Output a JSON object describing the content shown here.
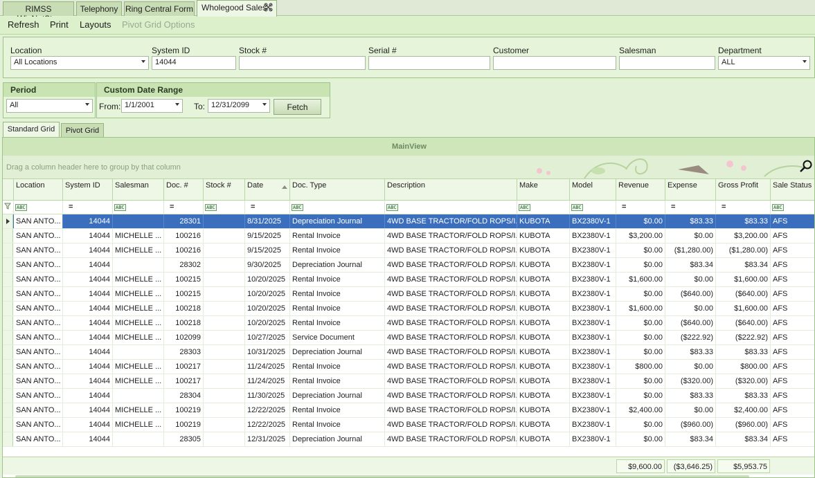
{
  "doc_tabs": [
    "RIMSS WinNetStar",
    "Telephony",
    "Ring Central Form",
    "Wholegood Sales"
  ],
  "toolbar": [
    "Refresh",
    "Print",
    "Layouts",
    "Pivot Grid Options"
  ],
  "filters": {
    "location": {
      "label": "Location",
      "value": "All Locations"
    },
    "system_id": {
      "label": "System ID",
      "value": "14044"
    },
    "stock": {
      "label": "Stock #",
      "value": ""
    },
    "serial": {
      "label": "Serial #",
      "value": ""
    },
    "customer": {
      "label": "Customer",
      "value": ""
    },
    "salesman": {
      "label": "Salesman",
      "value": ""
    },
    "department": {
      "label": "Department",
      "value": "ALL"
    }
  },
  "period": {
    "title": "Period",
    "value": "All"
  },
  "date_range": {
    "title": "Custom Date Range",
    "from_label": "From:",
    "from_value": "1/1/2001",
    "to_label": "To:",
    "to_value": "12/31/2099",
    "fetch_label": "Fetch"
  },
  "view_tabs": [
    "Standard Grid",
    "Pivot Grid"
  ],
  "grid": {
    "title": "MainView",
    "group_hint": "Drag a column header here to group by that column",
    "columns": [
      "Location",
      "System ID",
      "Salesman",
      "Doc. #",
      "Stock #",
      "Date",
      "Doc. Type",
      "Description",
      "Make",
      "Model",
      "Revenue",
      "Expense",
      "Gross Profit",
      "Sale Status"
    ],
    "rows": [
      [
        "SAN ANTO...",
        "14044",
        "",
        "28301",
        "",
        "8/31/2025",
        "Depreciation Journal",
        "4WD BASE TRACTOR/FOLD ROPS/I...",
        "KUBOTA",
        "BX2380V-1",
        "$0.00",
        "$83.33",
        "$83.33",
        "AFS"
      ],
      [
        "SAN ANTO...",
        "14044",
        "MICHELLE ...",
        "100216",
        "",
        "9/15/2025",
        "Rental Invoice",
        "4WD BASE TRACTOR/FOLD ROPS/I...",
        "KUBOTA",
        "BX2380V-1",
        "$3,200.00",
        "$0.00",
        "$3,200.00",
        "AFS"
      ],
      [
        "SAN ANTO...",
        "14044",
        "MICHELLE ...",
        "100216",
        "",
        "9/15/2025",
        "Rental Invoice",
        "4WD BASE TRACTOR/FOLD ROPS/I...",
        "KUBOTA",
        "BX2380V-1",
        "$0.00",
        "($1,280.00)",
        "($1,280.00)",
        "AFS"
      ],
      [
        "SAN ANTO...",
        "14044",
        "",
        "28302",
        "",
        "9/30/2025",
        "Depreciation Journal",
        "4WD BASE TRACTOR/FOLD ROPS/I...",
        "KUBOTA",
        "BX2380V-1",
        "$0.00",
        "$83.34",
        "$83.34",
        "AFS"
      ],
      [
        "SAN ANTO...",
        "14044",
        "MICHELLE ...",
        "100215",
        "",
        "10/20/2025",
        "Rental Invoice",
        "4WD BASE TRACTOR/FOLD ROPS/I...",
        "KUBOTA",
        "BX2380V-1",
        "$1,600.00",
        "$0.00",
        "$1,600.00",
        "AFS"
      ],
      [
        "SAN ANTO...",
        "14044",
        "MICHELLE ...",
        "100215",
        "",
        "10/20/2025",
        "Rental Invoice",
        "4WD BASE TRACTOR/FOLD ROPS/I...",
        "KUBOTA",
        "BX2380V-1",
        "$0.00",
        "($640.00)",
        "($640.00)",
        "AFS"
      ],
      [
        "SAN ANTO...",
        "14044",
        "MICHELLE ...",
        "100218",
        "",
        "10/20/2025",
        "Rental Invoice",
        "4WD BASE TRACTOR/FOLD ROPS/I...",
        "KUBOTA",
        "BX2380V-1",
        "$1,600.00",
        "$0.00",
        "$1,600.00",
        "AFS"
      ],
      [
        "SAN ANTO...",
        "14044",
        "MICHELLE ...",
        "100218",
        "",
        "10/20/2025",
        "Rental Invoice",
        "4WD BASE TRACTOR/FOLD ROPS/I...",
        "KUBOTA",
        "BX2380V-1",
        "$0.00",
        "($640.00)",
        "($640.00)",
        "AFS"
      ],
      [
        "SAN ANTO...",
        "14044",
        "MICHELLE ...",
        "102099",
        "",
        "10/27/2025",
        "Service Document",
        "4WD BASE TRACTOR/FOLD ROPS/I...",
        "KUBOTA",
        "BX2380V-1",
        "$0.00",
        "($222.92)",
        "($222.92)",
        "AFS"
      ],
      [
        "SAN ANTO...",
        "14044",
        "",
        "28303",
        "",
        "10/31/2025",
        "Depreciation Journal",
        "4WD BASE TRACTOR/FOLD ROPS/I...",
        "KUBOTA",
        "BX2380V-1",
        "$0.00",
        "$83.33",
        "$83.33",
        "AFS"
      ],
      [
        "SAN ANTO...",
        "14044",
        "MICHELLE ...",
        "100217",
        "",
        "11/24/2025",
        "Rental Invoice",
        "4WD BASE TRACTOR/FOLD ROPS/I...",
        "KUBOTA",
        "BX2380V-1",
        "$800.00",
        "$0.00",
        "$800.00",
        "AFS"
      ],
      [
        "SAN ANTO...",
        "14044",
        "MICHELLE ...",
        "100217",
        "",
        "11/24/2025",
        "Rental Invoice",
        "4WD BASE TRACTOR/FOLD ROPS/I...",
        "KUBOTA",
        "BX2380V-1",
        "$0.00",
        "($320.00)",
        "($320.00)",
        "AFS"
      ],
      [
        "SAN ANTO...",
        "14044",
        "",
        "28304",
        "",
        "11/30/2025",
        "Depreciation Journal",
        "4WD BASE TRACTOR/FOLD ROPS/I...",
        "KUBOTA",
        "BX2380V-1",
        "$0.00",
        "$83.33",
        "$83.33",
        "AFS"
      ],
      [
        "SAN ANTO...",
        "14044",
        "MICHELLE ...",
        "100219",
        "",
        "12/22/2025",
        "Rental Invoice",
        "4WD BASE TRACTOR/FOLD ROPS/I...",
        "KUBOTA",
        "BX2380V-1",
        "$2,400.00",
        "$0.00",
        "$2,400.00",
        "AFS"
      ],
      [
        "SAN ANTO...",
        "14044",
        "MICHELLE ...",
        "100219",
        "",
        "12/22/2025",
        "Rental Invoice",
        "4WD BASE TRACTOR/FOLD ROPS/I...",
        "KUBOTA",
        "BX2380V-1",
        "$0.00",
        "($960.00)",
        "($960.00)",
        "AFS"
      ],
      [
        "SAN ANTO...",
        "14044",
        "",
        "28305",
        "",
        "12/31/2025",
        "Depreciation Journal",
        "4WD BASE TRACTOR/FOLD ROPS/I...",
        "KUBOTA",
        "BX2380V-1",
        "$0.00",
        "$83.34",
        "$83.34",
        "AFS"
      ]
    ],
    "totals": {
      "revenue": "$9,600.00",
      "expense": "($3,646.25)",
      "gross_profit": "$5,953.75"
    }
  },
  "icons": {
    "close": "pin-close-icon",
    "search": "magnifier-icon",
    "filter": "funnel-icon"
  }
}
